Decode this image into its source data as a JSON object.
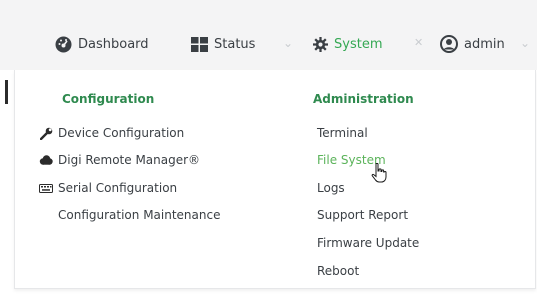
{
  "nav": {
    "dashboard": {
      "label": "Dashboard",
      "icon": "dashboard-gauge-icon"
    },
    "status": {
      "label": "Status",
      "icon": "grid-icon"
    },
    "system": {
      "label": "System",
      "icon": "gear-icon"
    },
    "admin": {
      "label": "admin",
      "icon": "user-circle-icon"
    },
    "separator_icon": "chevron-down-icon",
    "separator_close_icon": "close-icon",
    "active_color": "#34a853"
  },
  "menu": {
    "configuration": {
      "heading": "Configuration",
      "items": [
        {
          "label": "Device Configuration",
          "icon": "wrench-icon"
        },
        {
          "label": "Digi Remote Manager®",
          "icon": "cloud-icon"
        },
        {
          "label": "Serial Configuration",
          "icon": "keyboard-icon"
        },
        {
          "label": "Configuration Maintenance",
          "icon": ""
        }
      ]
    },
    "administration": {
      "heading": "Administration",
      "items": [
        {
          "label": "Terminal"
        },
        {
          "label": "File System"
        },
        {
          "label": "Logs"
        },
        {
          "label": "Support Report"
        },
        {
          "label": "Firmware Update"
        },
        {
          "label": "Reboot"
        }
      ]
    },
    "heading_color": "#2f8a4f",
    "hover_color": "#5bb35a"
  }
}
